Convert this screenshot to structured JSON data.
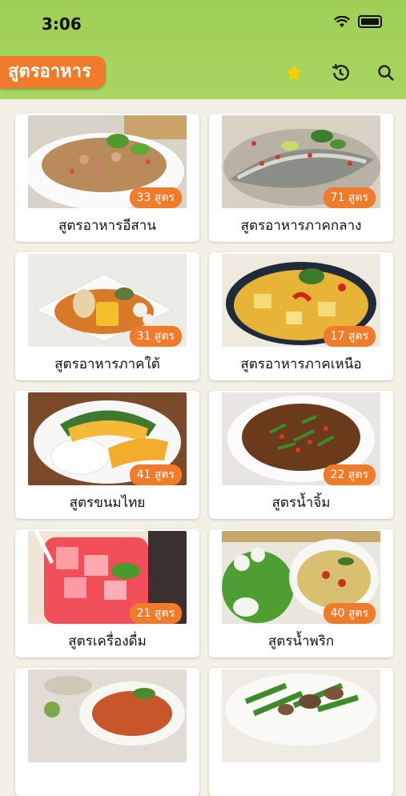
{
  "status": {
    "time": "3:06"
  },
  "header": {
    "title": "สูตรอาหาร",
    "icons": [
      "star-icon",
      "history-icon",
      "search-icon"
    ]
  },
  "categories": [
    {
      "label": "สูตรอาหารอีสาน",
      "count": "33 สูตร"
    },
    {
      "label": "สูตรอาหารภาคกลาง",
      "count": "71 สูตร"
    },
    {
      "label": "สูตรอาหารภาคใต้",
      "count": "31 สูตร"
    },
    {
      "label": "สูตรอาหารภาคเหนือ",
      "count": "17 สูตร"
    },
    {
      "label": "สูตรขนมไทย",
      "count": "41 สูตร"
    },
    {
      "label": "สูตรน้ำจิ้ม",
      "count": "22 สูตร"
    },
    {
      "label": "สูตรเครื่องดื่ม",
      "count": "21 สูตร"
    },
    {
      "label": "สูตรน้ำพริก",
      "count": "40 สูตร"
    }
  ],
  "colors": {
    "header": "#a9d662",
    "accent": "#f07b2a",
    "background": "#f3f0e6",
    "star": "#f5d000"
  }
}
